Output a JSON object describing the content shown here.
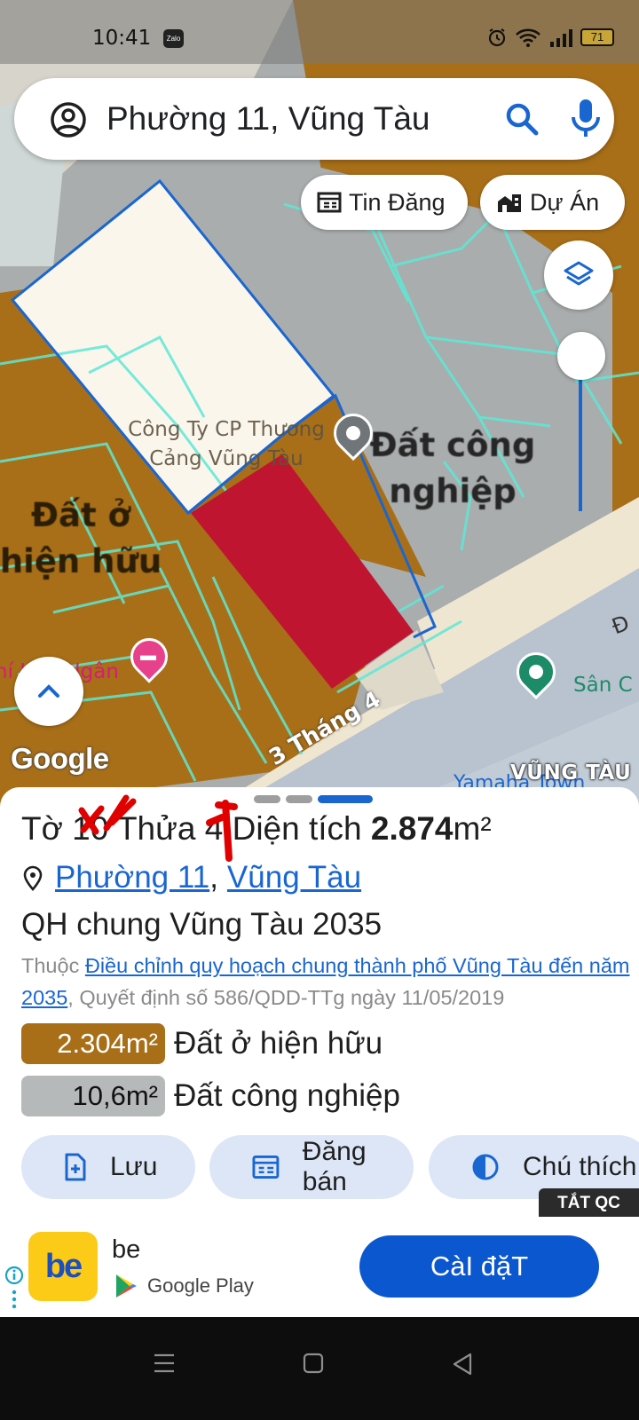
{
  "status_bar": {
    "time": "10:41",
    "notification_app": "Zalo",
    "battery": "71"
  },
  "search": {
    "value": "Phường 11, Vũng Tàu"
  },
  "chips": {
    "news": "Tin Đăng",
    "projects": "Dự Án"
  },
  "map": {
    "labels": {
      "company_line1": "Công Ty CP Thương",
      "company_line2": "Cảng Vũng Tàu",
      "industrial_line1": "Đất công",
      "industrial_line2": "nghiệp",
      "residential_line1": "Đất ở",
      "residential_line2": "hiện hữu",
      "hotel": "hí Kim Ngân",
      "road": "3 Tháng 4",
      "poi": "Sân C",
      "yamaha": "Yamaha Town",
      "city": "VŨNG TÀU",
      "edge_letter": "Đ",
      "google": "Google"
    },
    "colors": {
      "residential": "#a86f18",
      "industrial": "#b6b9ba",
      "selected_parcel": "#c01530",
      "boundary": "#1a66d1",
      "parcel_lines": "#5ee8d6"
    }
  },
  "sheet": {
    "sheet_label": "Tờ",
    "sheet_no": "10",
    "parcel_label": "Thửa",
    "parcel_no": "4",
    "area_label": "Diện tích",
    "area_value": "2.874",
    "area_unit": "m²",
    "ward": "Phường 11",
    "separator": ",",
    "city": "Vũng Tàu",
    "plan_title": "QH chung Vũng Tàu 2035",
    "belongs_label": "Thuộc",
    "plan_link": "Điều chỉnh quy hoạch chung thành phố Vũng Tàu đến năm 2035",
    "plan_decision": ", Quyết định số 586/QDD-TTg ngày 11/05/2019",
    "zones": [
      {
        "area": "2.304m²",
        "label": "Đất ở hiện hữu"
      },
      {
        "area": "10,6m²",
        "label": "Đất công nghiệp"
      }
    ],
    "actions": {
      "save": "Lưu",
      "post": "Đăng bán",
      "legend": "Chú thích"
    }
  },
  "ad": {
    "off_label": "TẮT QC",
    "logo_text": "be",
    "app_name": "be",
    "store": "Google Play",
    "install": "CàI đặT"
  }
}
